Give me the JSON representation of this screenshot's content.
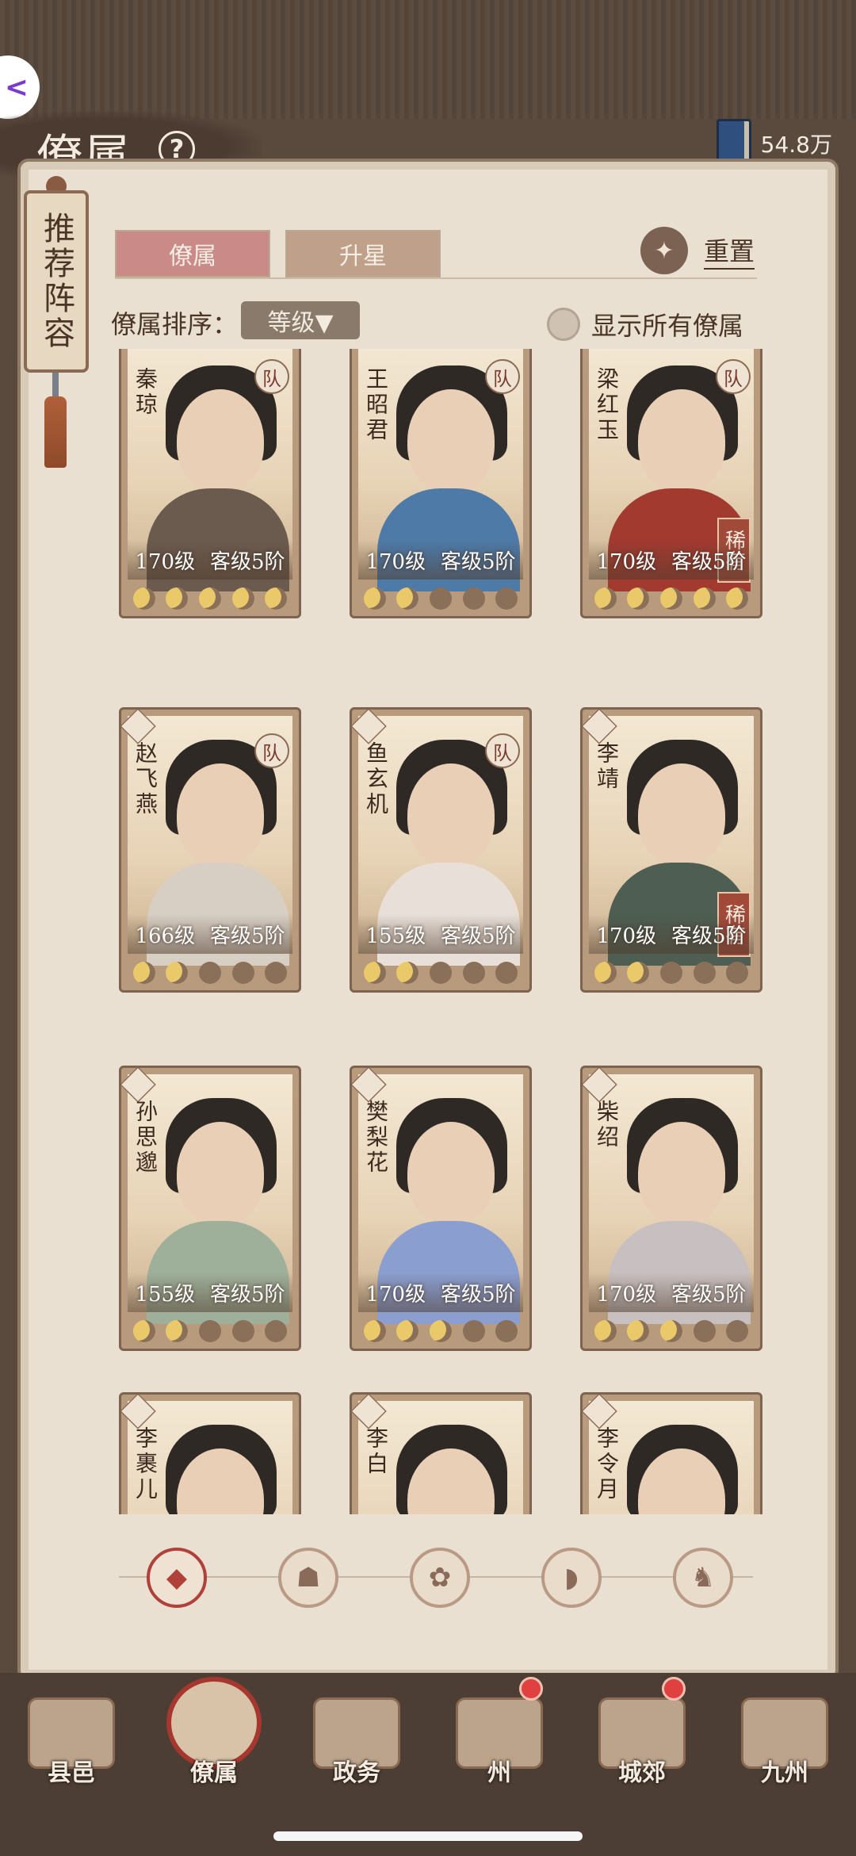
{
  "header": {
    "title": "僚属",
    "currency_value": "54.8万"
  },
  "side_scroll": {
    "label": "推荐阵容"
  },
  "tabs": [
    {
      "label": "僚属"
    },
    {
      "label": "升星"
    }
  ],
  "reset_label": "重置",
  "sort": {
    "label": "僚属排序：",
    "value": "等级▼"
  },
  "show_all_label": "显示所有僚属",
  "cards": [
    {
      "name": "秦琼",
      "level": "170级",
      "rank": "客级5阶",
      "team": "队",
      "rare": "",
      "moons": 5,
      "body": "#6b5a4e"
    },
    {
      "name": "王昭君",
      "level": "170级",
      "rank": "客级5阶",
      "team": "队",
      "rare": "",
      "moons": 2,
      "body": "#4e7aa8"
    },
    {
      "name": "梁红玉",
      "level": "170级",
      "rank": "客级5阶",
      "team": "队",
      "rare": "稀有",
      "moons": 5,
      "body": "#a23a30"
    },
    {
      "name": "赵飞燕",
      "level": "166级",
      "rank": "客级5阶",
      "team": "队",
      "rare": "",
      "moons": 2,
      "body": "#d8cfc4"
    },
    {
      "name": "鱼玄机",
      "level": "155级",
      "rank": "客级5阶",
      "team": "队",
      "rare": "",
      "moons": 2,
      "body": "#e8e0d8"
    },
    {
      "name": "李靖",
      "level": "170级",
      "rank": "客级5阶",
      "team": "",
      "rare": "稀有",
      "moons": 2,
      "body": "#4e5e52"
    },
    {
      "name": "孙思邈",
      "level": "155级",
      "rank": "客级5阶",
      "team": "",
      "rare": "",
      "moons": 2,
      "body": "#9fb09a"
    },
    {
      "name": "樊梨花",
      "level": "170级",
      "rank": "客级5阶",
      "team": "",
      "rare": "",
      "moons": 3,
      "body": "#8a9ed0"
    },
    {
      "name": "柴绍",
      "level": "170级",
      "rank": "客级5阶",
      "team": "",
      "rare": "",
      "moons": 3,
      "body": "#c8c0c0"
    },
    {
      "name": "李裹儿",
      "level": "",
      "rank": "",
      "team": "",
      "rare": "",
      "moons": 0,
      "body": "#e0c0a0"
    },
    {
      "name": "李白",
      "level": "",
      "rank": "",
      "team": "",
      "rare": "",
      "moons": 0,
      "body": "#4a4440"
    },
    {
      "name": "李令月",
      "level": "",
      "rank": "",
      "team": "",
      "rare": "",
      "moons": 0,
      "body": "#d0b0a0"
    }
  ],
  "filters": [
    {
      "icon": "all-icon",
      "glyph": "◆",
      "active": true
    },
    {
      "icon": "attribute-icon-1",
      "glyph": "☗",
      "active": false
    },
    {
      "icon": "attribute-icon-2",
      "glyph": "✿",
      "active": false
    },
    {
      "icon": "attribute-icon-3",
      "glyph": "◗",
      "active": false
    },
    {
      "icon": "attribute-icon-4",
      "glyph": "♞",
      "active": false
    }
  ],
  "nav": [
    {
      "label": "县邑",
      "active": false,
      "dot": false
    },
    {
      "label": "僚属",
      "active": true,
      "dot": false
    },
    {
      "label": "政务",
      "active": false,
      "dot": false
    },
    {
      "label": "州",
      "active": false,
      "dot": true
    },
    {
      "label": "城郊",
      "active": false,
      "dot": true
    },
    {
      "label": "九州",
      "active": false,
      "dot": false
    }
  ]
}
